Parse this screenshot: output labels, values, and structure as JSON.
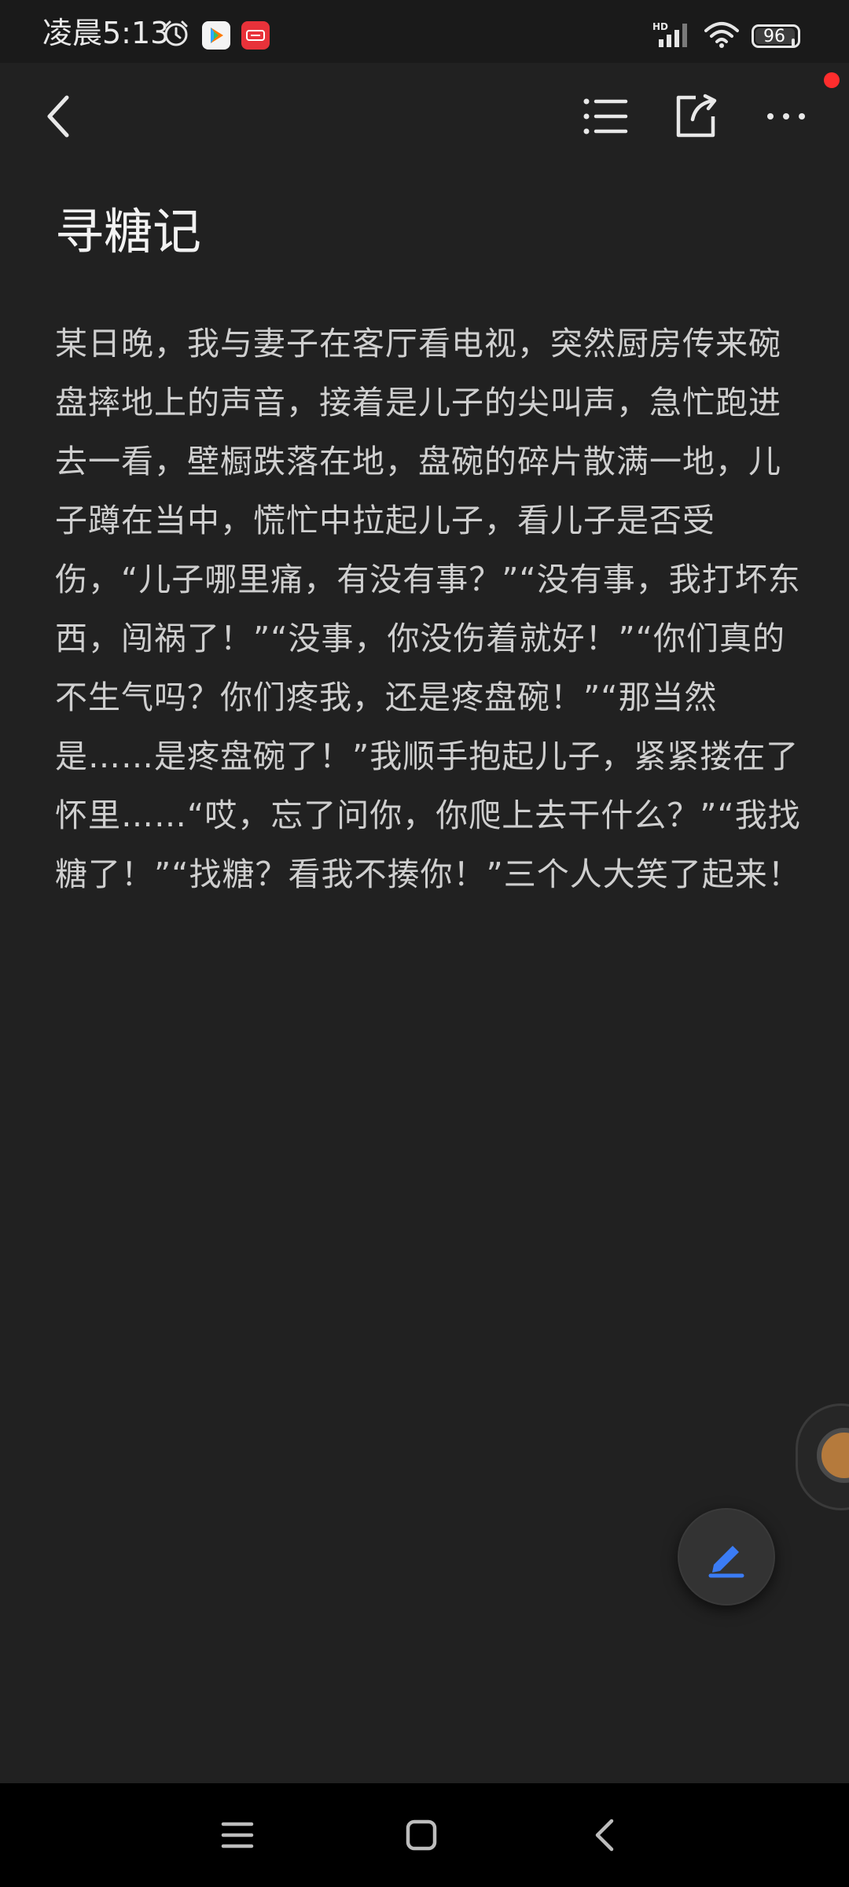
{
  "status_bar": {
    "time": "凌晨5:13",
    "battery": "96",
    "battery_fraction": 0.96,
    "notification_apps": [
      "腾讯视频",
      "看点"
    ],
    "network_label": "HD"
  },
  "toolbar": {
    "back_icon": "chevron-left-icon",
    "outline_icon": "list-icon",
    "share_icon": "share-icon",
    "more_icon": "more-icon",
    "notification_dot_color": "#ff2d2d"
  },
  "note": {
    "title": "寻糖记",
    "body": "某日晚，我与妻子在客厅看电视，突然厨房传来碗盘摔地上的声音，接着是儿子的尖叫声，急忙跑进去一看，壁橱跌落在地，盘碗的碎片散满一地，儿子蹲在当中，慌忙中拉起儿子，看儿子是否受伤，“儿子哪里痛，有没有事？”“没有事，我打坏东西，闯祸了！”“没事，你没伤着就好！”“你们真的不生气吗？你们疼我，还是疼盘碗！”“那当然是……是疼盘碗了！”我顺手抱起儿子，紧紧搂在了怀里……“哎，忘了问你，你爬上去干什么？”“我找糖了！”“找糖？看我不揍你！”三个人大笑了起来！"
  },
  "fab": {
    "icon": "edit-pen-icon",
    "accent": "#3b7cf5"
  },
  "nav_bar": {
    "menu_icon": "menu-icon",
    "home_icon": "home-icon",
    "back_icon": "back-icon"
  }
}
